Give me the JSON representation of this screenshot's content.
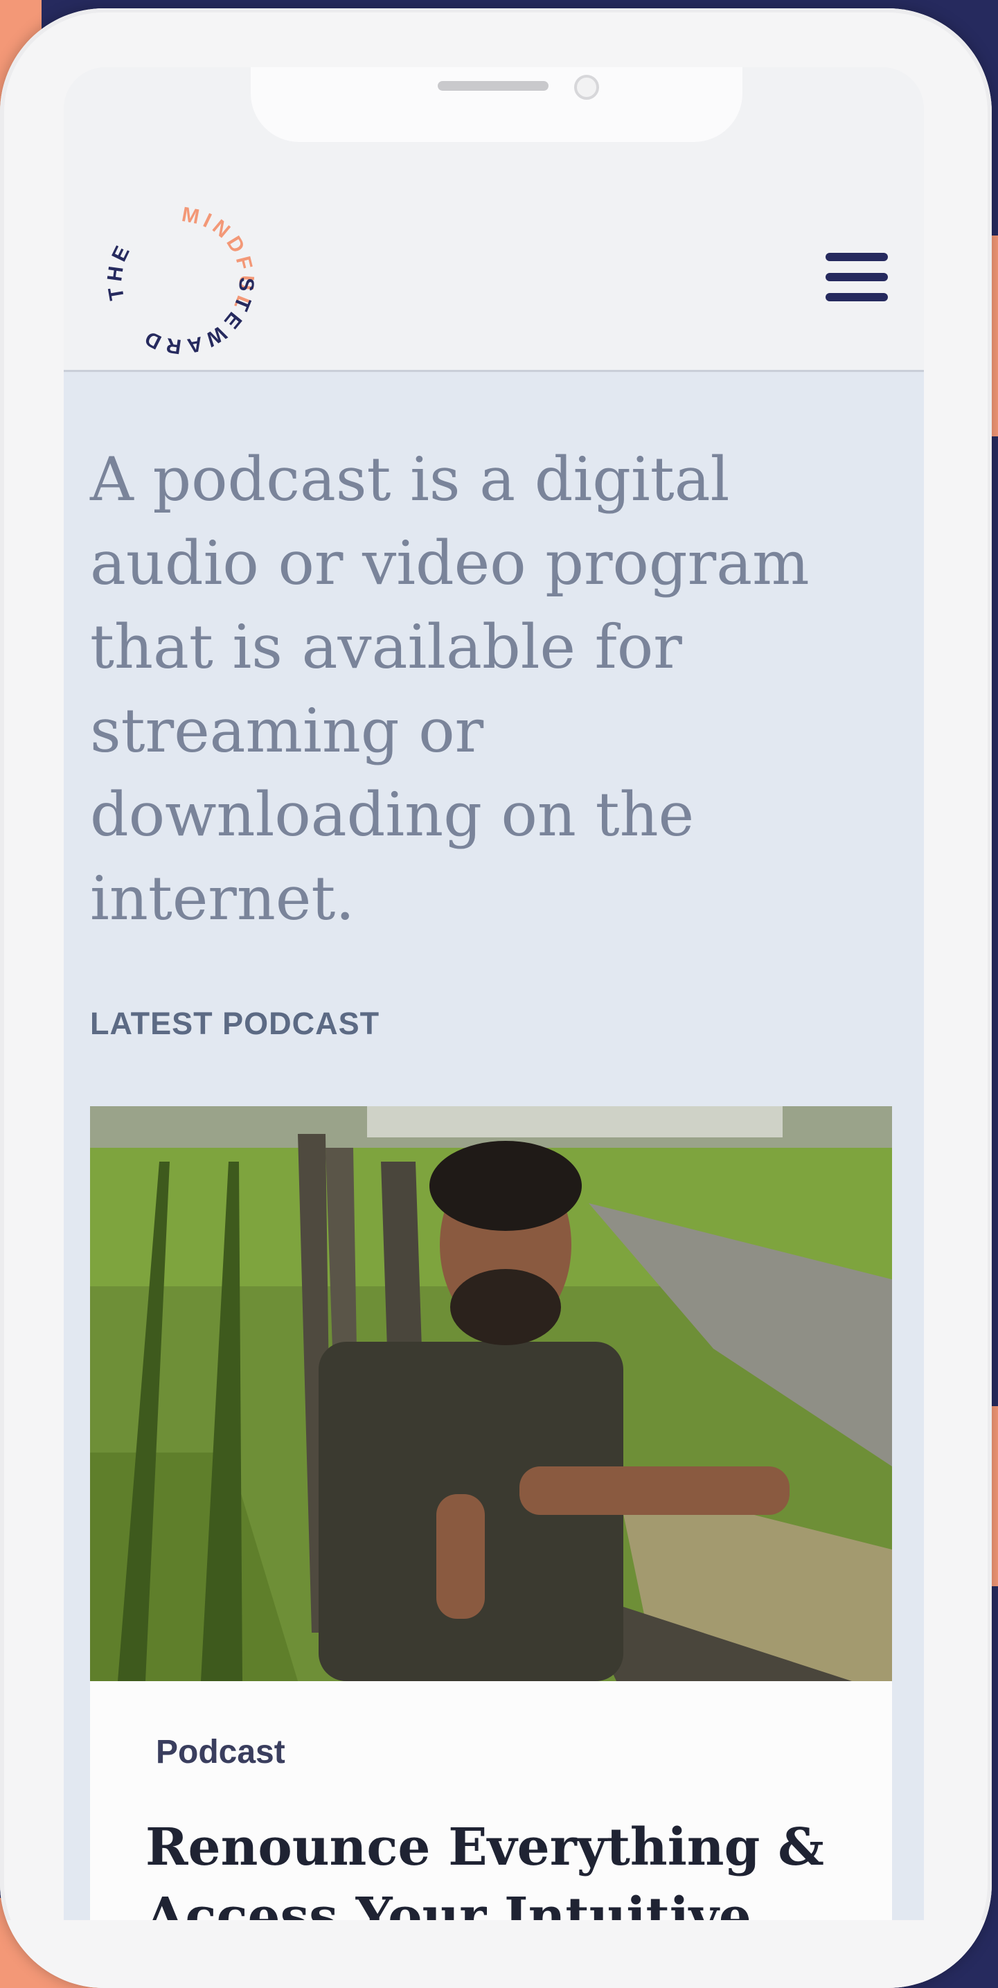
{
  "logo": {
    "top_text": "MINDFUL",
    "left_text": "THE",
    "right_text": "STEWARD",
    "color_top": "#f39877",
    "color_rest": "#262a5e"
  },
  "menu": {
    "icon": "hamburger-menu-icon"
  },
  "hero": {
    "text": "A podcast is a digital audio or video program that is available for streaming or downloading on the internet."
  },
  "latest": {
    "label": "LATEST PODCAST",
    "card": {
      "category": "Podcast",
      "title": "Renounce Everything & Access Your Intuitive"
    }
  },
  "colors": {
    "navy": "#262a5e",
    "orange": "#f39877",
    "hero_bg": "#e2e8f1",
    "hero_text": "#7a849a"
  }
}
